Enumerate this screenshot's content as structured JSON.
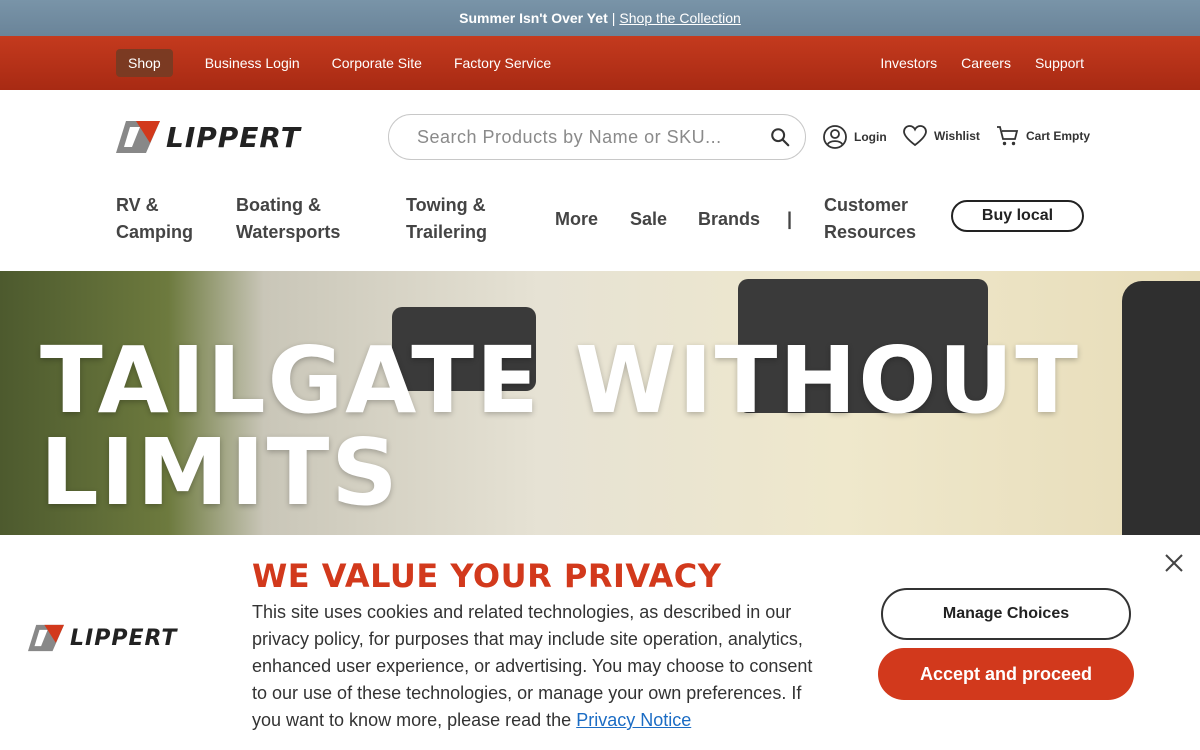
{
  "announcement": {
    "text": "Summer Isn't Over Yet",
    "separator": "|",
    "link": "Shop the Collection"
  },
  "utility_nav": {
    "left": [
      "Shop",
      "Business Login",
      "Corporate Site",
      "Factory Service"
    ],
    "right": [
      "Investors",
      "Careers",
      "Support"
    ]
  },
  "brand": {
    "name": "LIPPERT"
  },
  "search": {
    "placeholder": "Search Products by Name or SKU..."
  },
  "account": {
    "login": "Login",
    "wishlist": "Wishlist",
    "cart": "Cart Empty"
  },
  "main_nav": {
    "rv": {
      "line1": "RV &",
      "line2": "Camping"
    },
    "boating": {
      "line1": "Boating &",
      "line2": "Watersports"
    },
    "towing": {
      "line1": "Towing &",
      "line2": "Trailering"
    },
    "more": "More",
    "sale": "Sale",
    "brands": "Brands",
    "divider": "|",
    "customer": {
      "line1": "Customer",
      "line2": "Resources"
    },
    "buy_local": "Buy local"
  },
  "hero": {
    "line1": "TAILGATE WITHOUT",
    "line2": "LIMITS"
  },
  "privacy": {
    "title": "WE VALUE YOUR PRIVACY",
    "body": "This site uses cookies and related technologies, as described in our privacy policy, for purposes that may include site operation, analytics, enhanced user experience, or advertising. You may choose to consent to our use of these technologies, or manage your own preferences. If you want to know more, please read the",
    "link": "Privacy Notice",
    "manage": "Manage Choices",
    "accept": "Accept and proceed"
  },
  "colors": {
    "brand_red": "#d2391c",
    "utility_bar": "#b5321a",
    "announcement_bar": "#6f889c",
    "link_blue": "#1b6cc4"
  }
}
